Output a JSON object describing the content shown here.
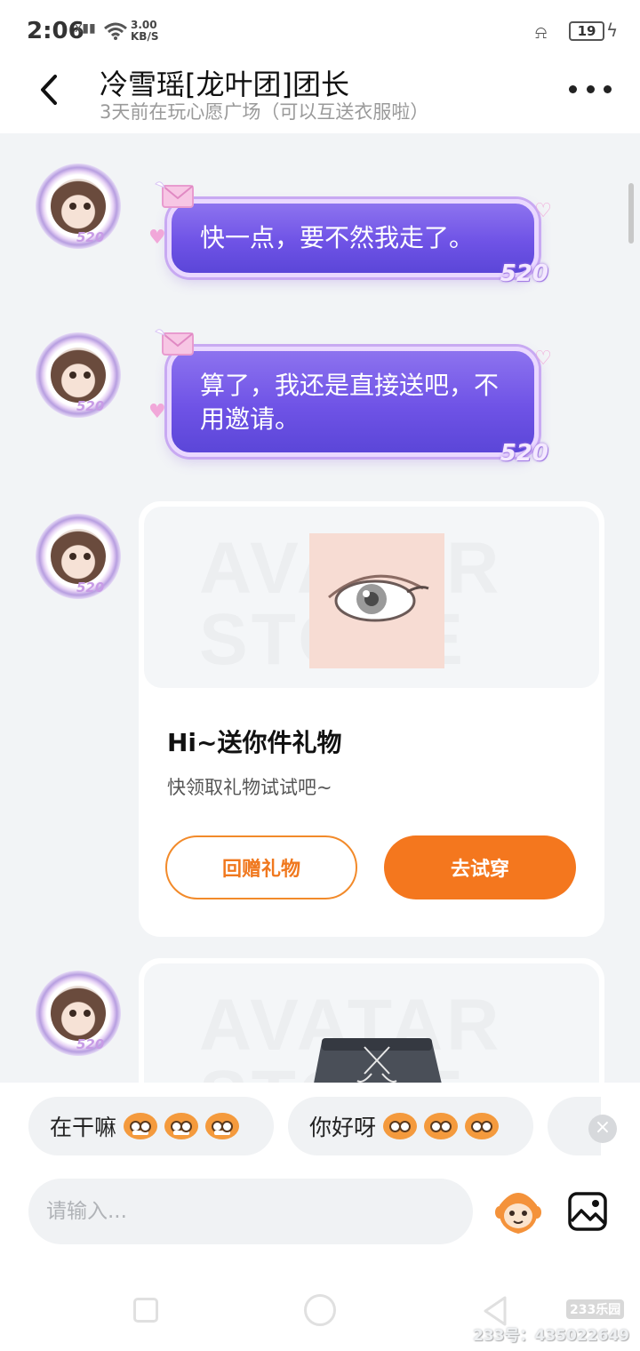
{
  "status_bar": {
    "time": "2:06",
    "network": "x",
    "speed_value": "3.00",
    "speed_unit": "KB/S",
    "battery": "19"
  },
  "header": {
    "title": "冷雪瑶[龙叶团]团长",
    "subtitle": "3天前在玩心愿广场（可以互送衣服啦）"
  },
  "messages": [
    {
      "type": "bubble",
      "text": "快一点，要不然我走了。",
      "badge": "520",
      "avatar_tag": "520"
    },
    {
      "type": "bubble",
      "text": "算了，我还是直接送吧，不用邀请。",
      "badge": "520",
      "avatar_tag": "520"
    },
    {
      "type": "gift_card",
      "watermark": "AVATAR STORE",
      "title": "Hi~送你件礼物",
      "desc": "快领取礼物试试吧~",
      "return_gift_label": "回赠礼物",
      "try_on_label": "去试穿",
      "avatar_tag": "520"
    },
    {
      "type": "gift_card_partial",
      "watermark": "AVATAR STORE",
      "avatar_tag": "520"
    }
  ],
  "quick_replies": [
    {
      "label": "在干嘛",
      "emoji": "grinning-monkey"
    },
    {
      "label": "你好呀",
      "emoji": "smiling-monkey"
    }
  ],
  "input": {
    "placeholder": "请输入..."
  },
  "watermark": {
    "logo": "233乐园",
    "id_text": "233号：435022649"
  },
  "colors": {
    "accent_orange": "#f4771e",
    "bubble_purple": "#6f53e6"
  }
}
